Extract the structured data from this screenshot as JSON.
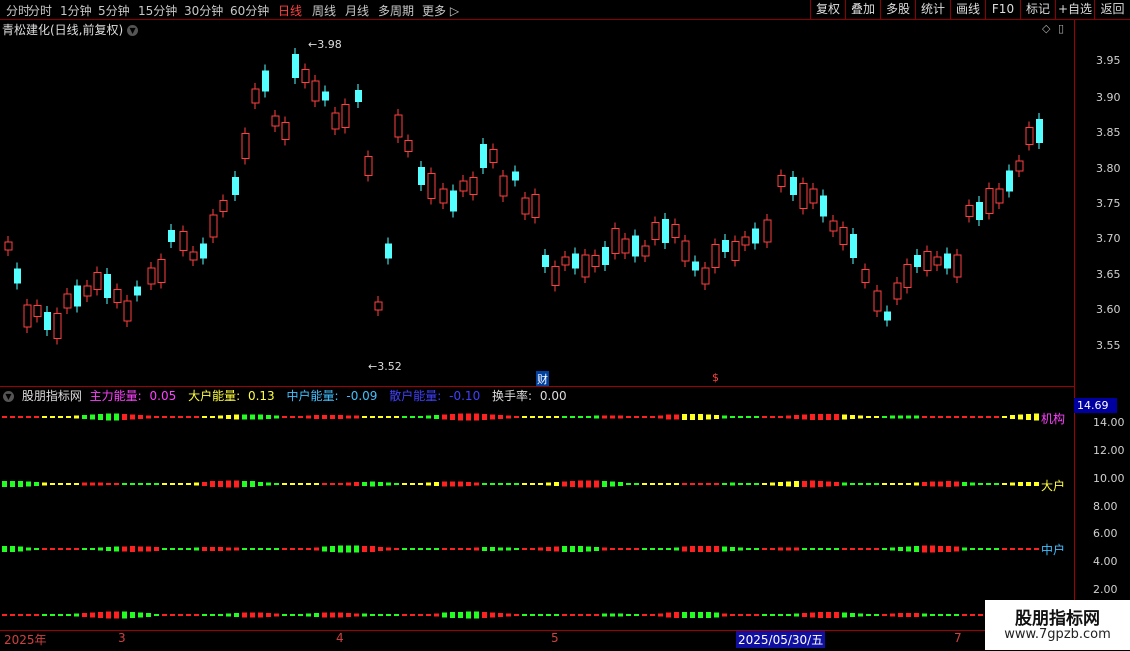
{
  "toolbar": {
    "periods": [
      "分时",
      "1分钟",
      "5分钟",
      "15分钟",
      "30分钟",
      "60分钟",
      "日线",
      "周线",
      "月线",
      "多周期",
      "更多"
    ],
    "active": "日线",
    "right_buttons": [
      "复权",
      "叠加",
      "多股",
      "统计",
      "画线",
      "F10",
      "标记",
      "+自选",
      "返回"
    ]
  },
  "chart_title": "青松建化(日线,前复权)",
  "price_axis": [
    "3.95",
    "3.90",
    "3.85",
    "3.80",
    "3.75",
    "3.70",
    "3.65",
    "3.60",
    "3.55"
  ],
  "markers": {
    "high": "3.98",
    "low": "3.52",
    "fin": "财",
    "dollar": "$"
  },
  "indicator": {
    "name": "股朋指标网",
    "items": [
      {
        "label": "主力能量:",
        "value": "0.05",
        "color": "#ff40ff"
      },
      {
        "label": "大户能量:",
        "value": "0.13",
        "color": "#ffff40"
      },
      {
        "label": "中户能量:",
        "value": "-0.09",
        "color": "#40c0ff"
      },
      {
        "label": "散户能量:",
        "value": "-0.10",
        "color": "#4040ff"
      },
      {
        "label": "换手率:",
        "value": "0.00",
        "color": "#dddddd"
      }
    ],
    "axis": [
      "14.00",
      "12.00",
      "10.00",
      "8.00",
      "6.00",
      "4.00",
      "2.00"
    ],
    "current": "14.69",
    "line_labels": [
      {
        "text": "机构",
        "color": "#ff40ff"
      },
      {
        "text": "大户",
        "color": "#ffff40"
      },
      {
        "text": "中户",
        "color": "#40c0ff"
      }
    ]
  },
  "date_axis": [
    "2025年",
    "3",
    "4",
    "5",
    "2025/05/30/五",
    "7"
  ],
  "watermark": {
    "title": "股朋指标网",
    "url": "www.7gpzb.com"
  }
}
